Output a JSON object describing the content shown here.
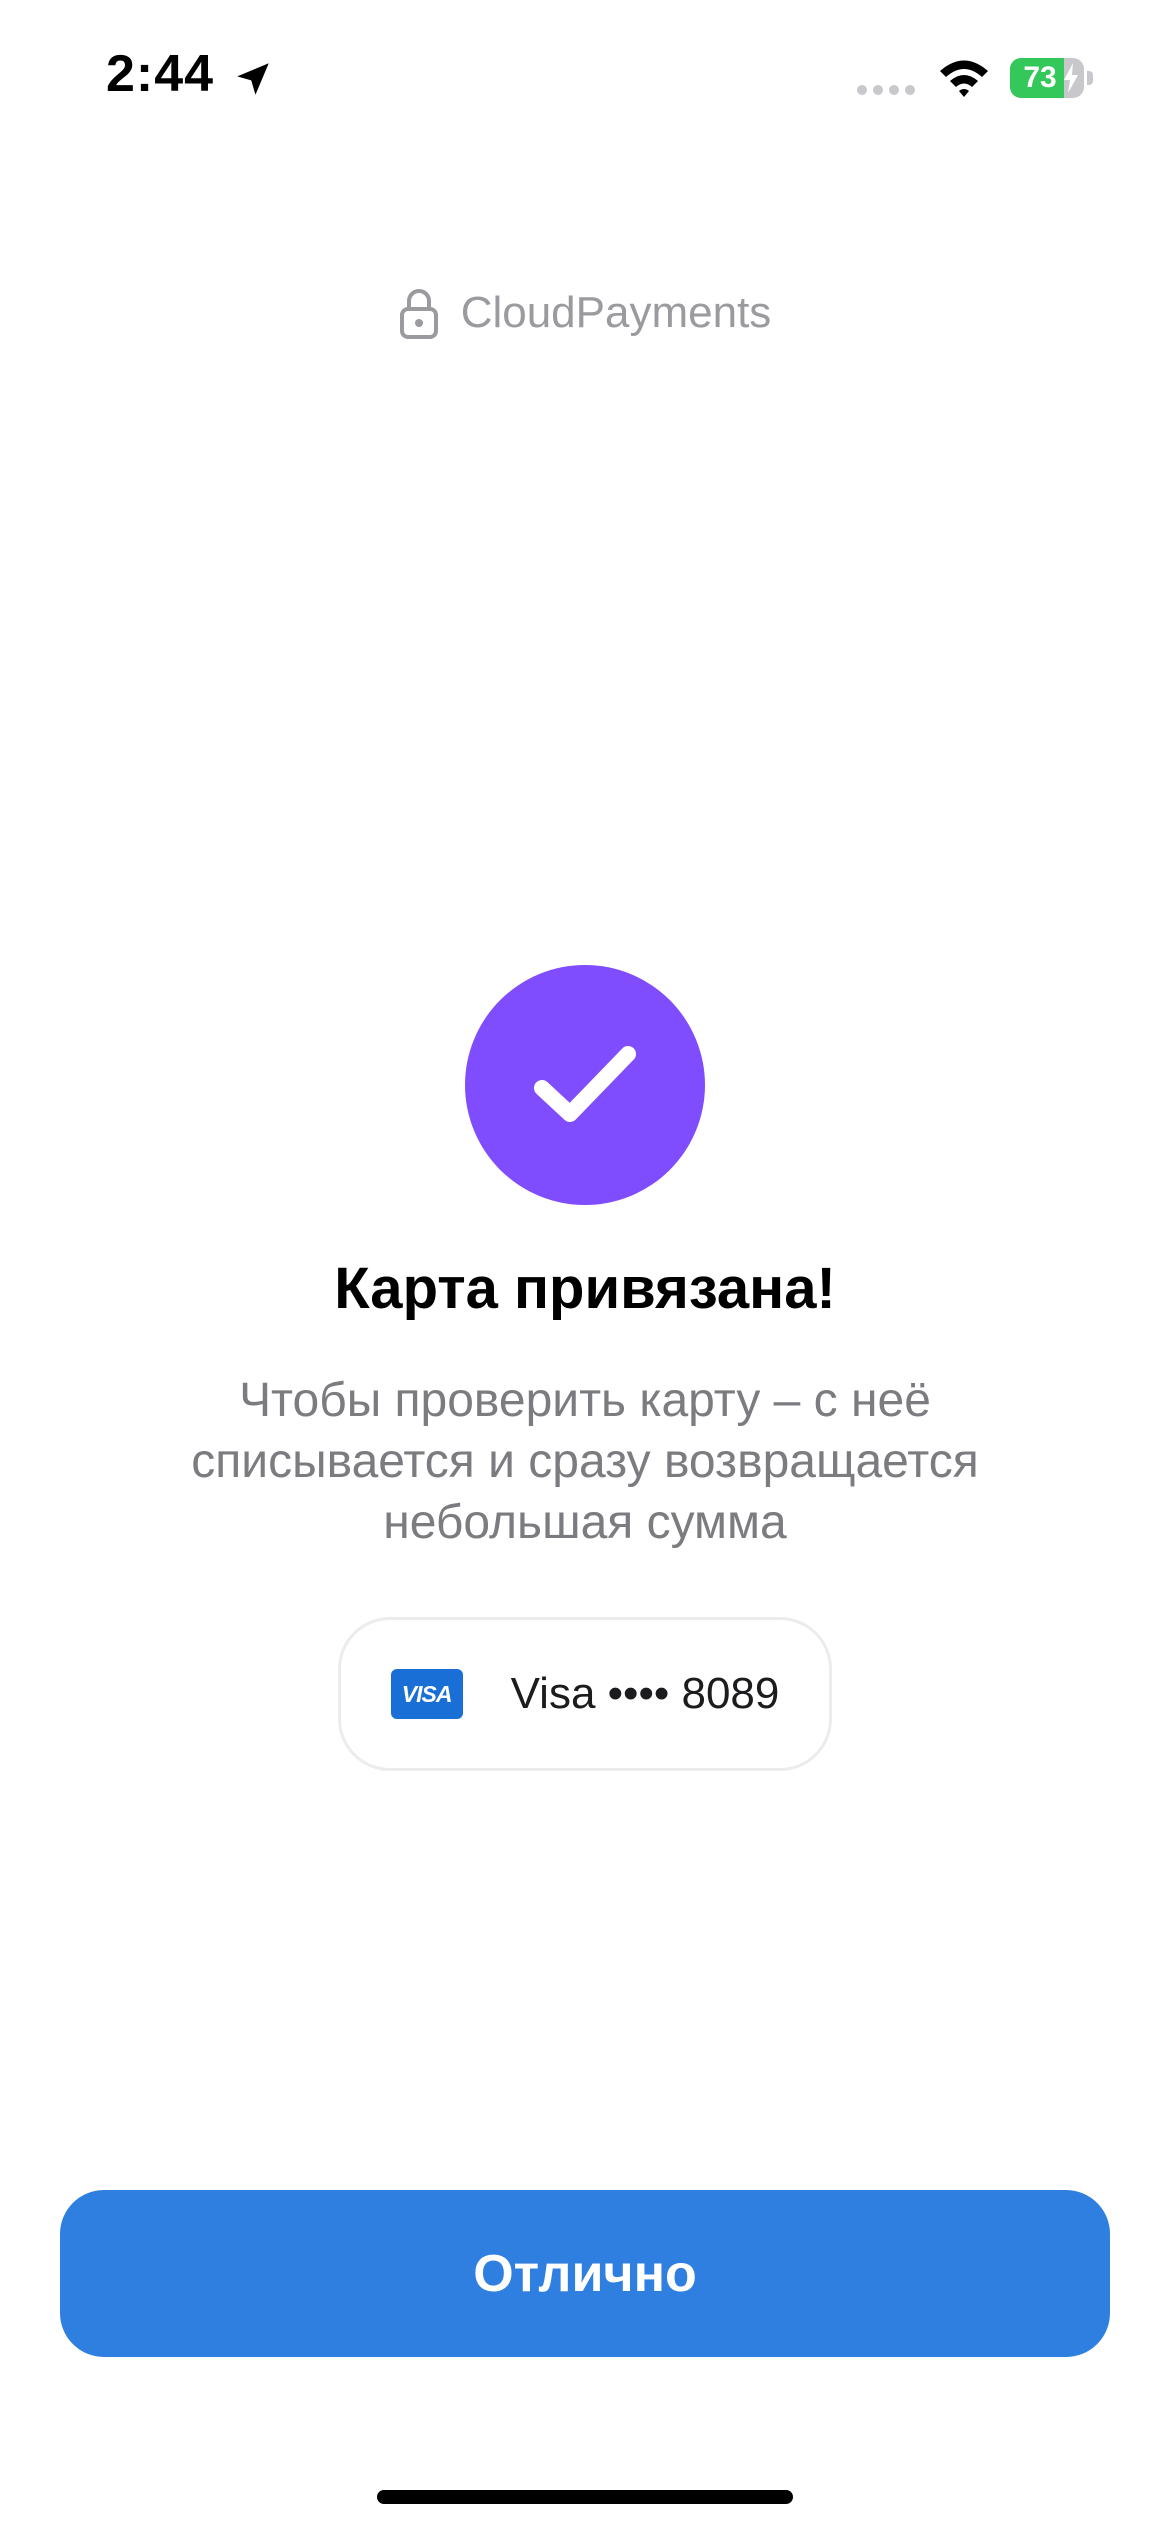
{
  "status_bar": {
    "time": "2:44",
    "battery_level": 73,
    "battery_text": "73",
    "battery_color": "#34c759",
    "icons": [
      "location-arrow-icon",
      "cellular-signal-icon",
      "wifi-icon",
      "battery-icon",
      "charging-bolt-icon"
    ]
  },
  "header": {
    "brand": "CloudPayments",
    "icon": "lock-icon"
  },
  "success": {
    "icon": "check-icon",
    "circle_color": "#7f4dfd",
    "title": "Карта привязана!",
    "description": "Чтобы проверить карту – с неё списывается и сразу возвращается небольшая сумма"
  },
  "card": {
    "network_badge": "VISA",
    "label": "Visa •••• 8089"
  },
  "actions": {
    "primary_label": "Отлично",
    "primary_color": "#2f7fe0"
  }
}
